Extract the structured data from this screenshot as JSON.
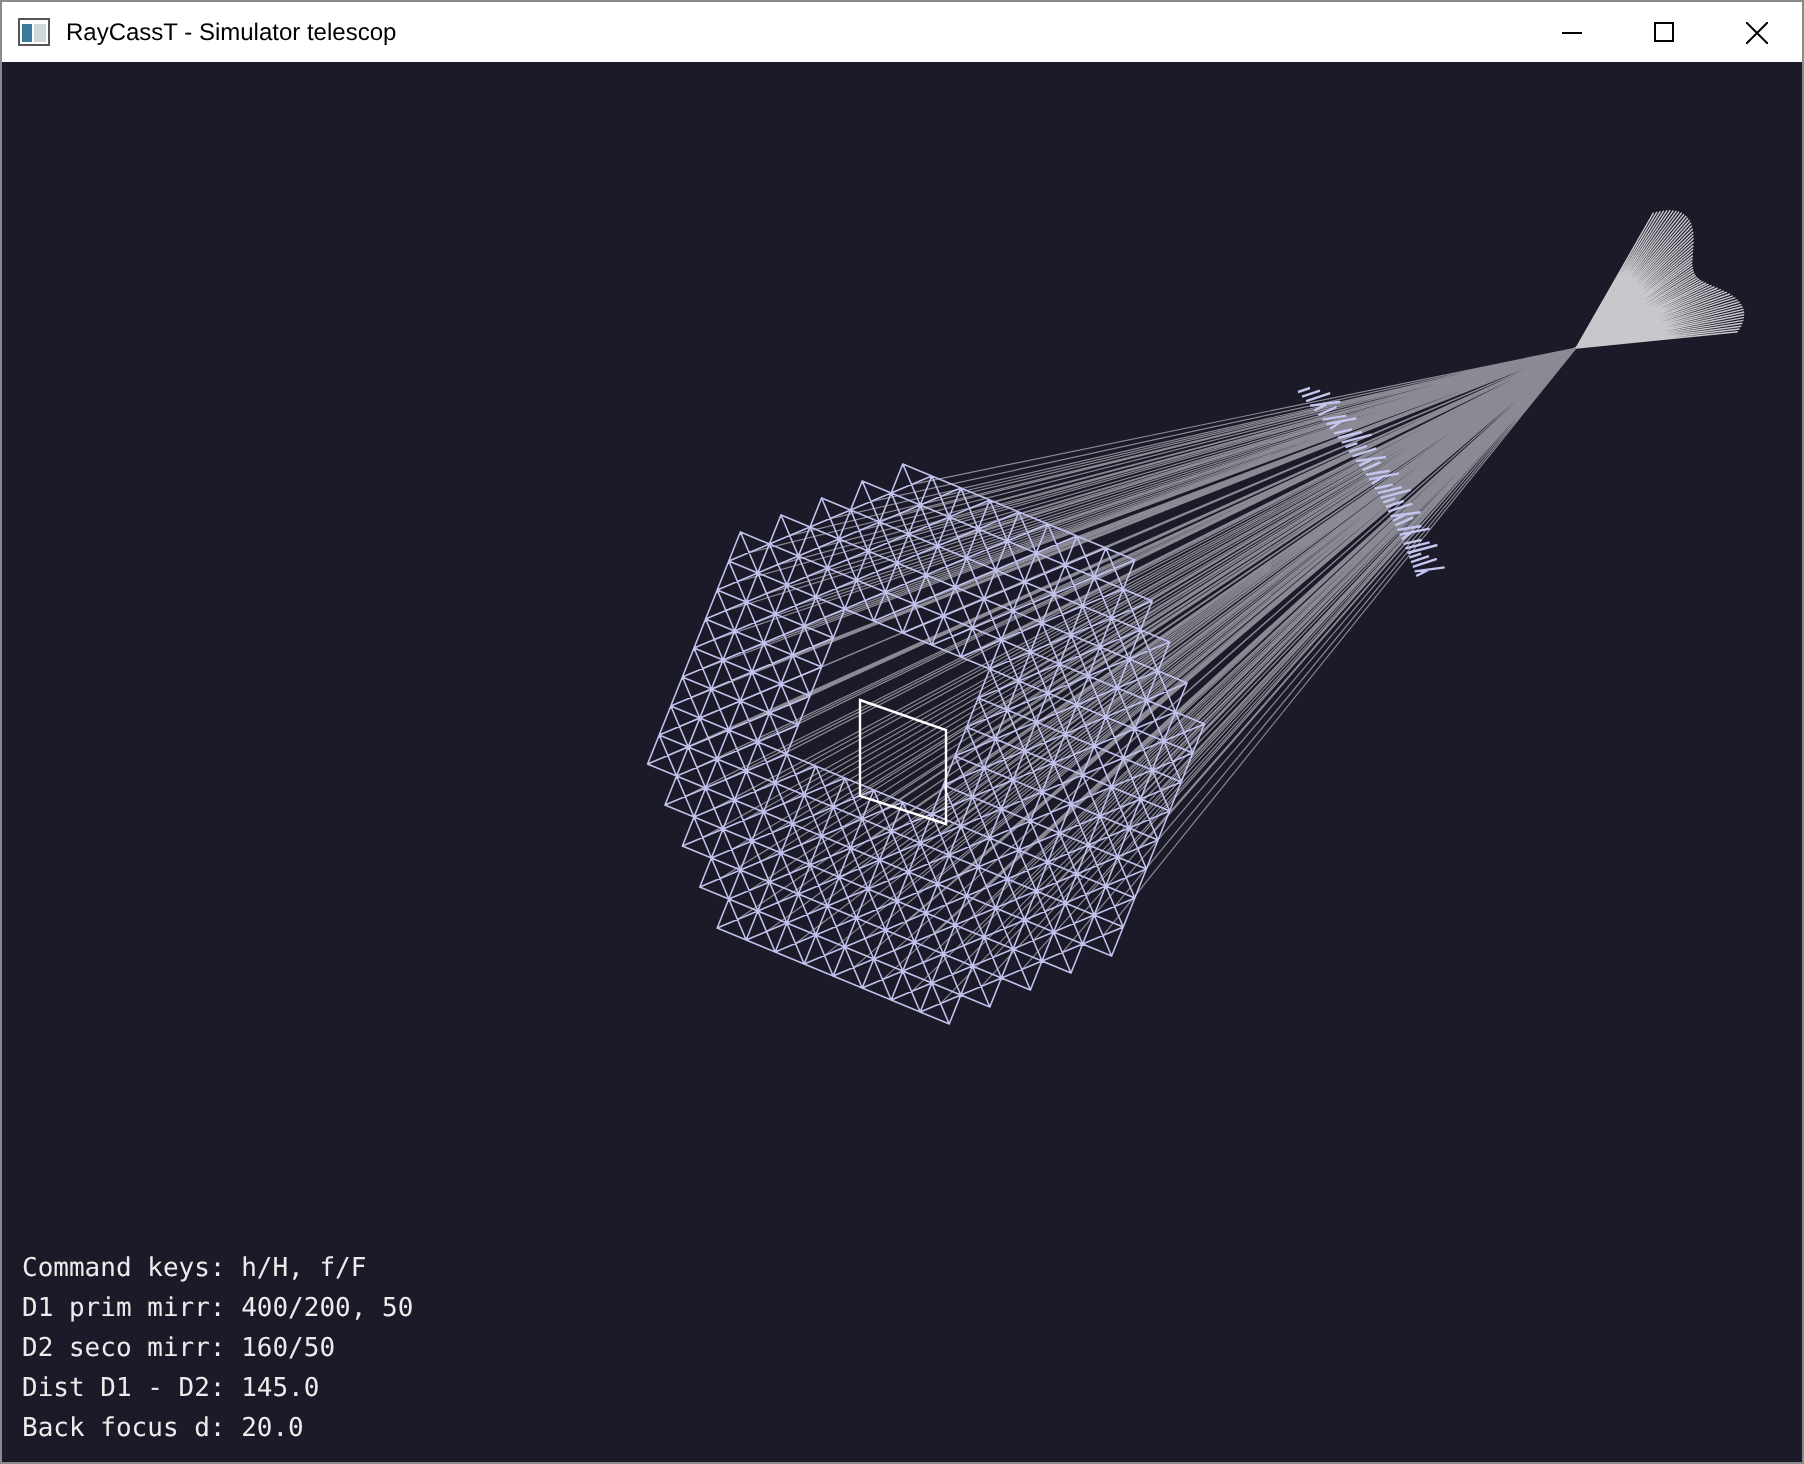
{
  "window": {
    "title": "RayCassT - Simulator telescop"
  },
  "info_lines": [
    "Command keys: h/H, f/F",
    "D1 prim mirr: 400/200, 50",
    "D2 seco mirr: 160/50",
    "Dist D1 - D2: 145.0",
    "Back focus d: 20.0"
  ]
}
